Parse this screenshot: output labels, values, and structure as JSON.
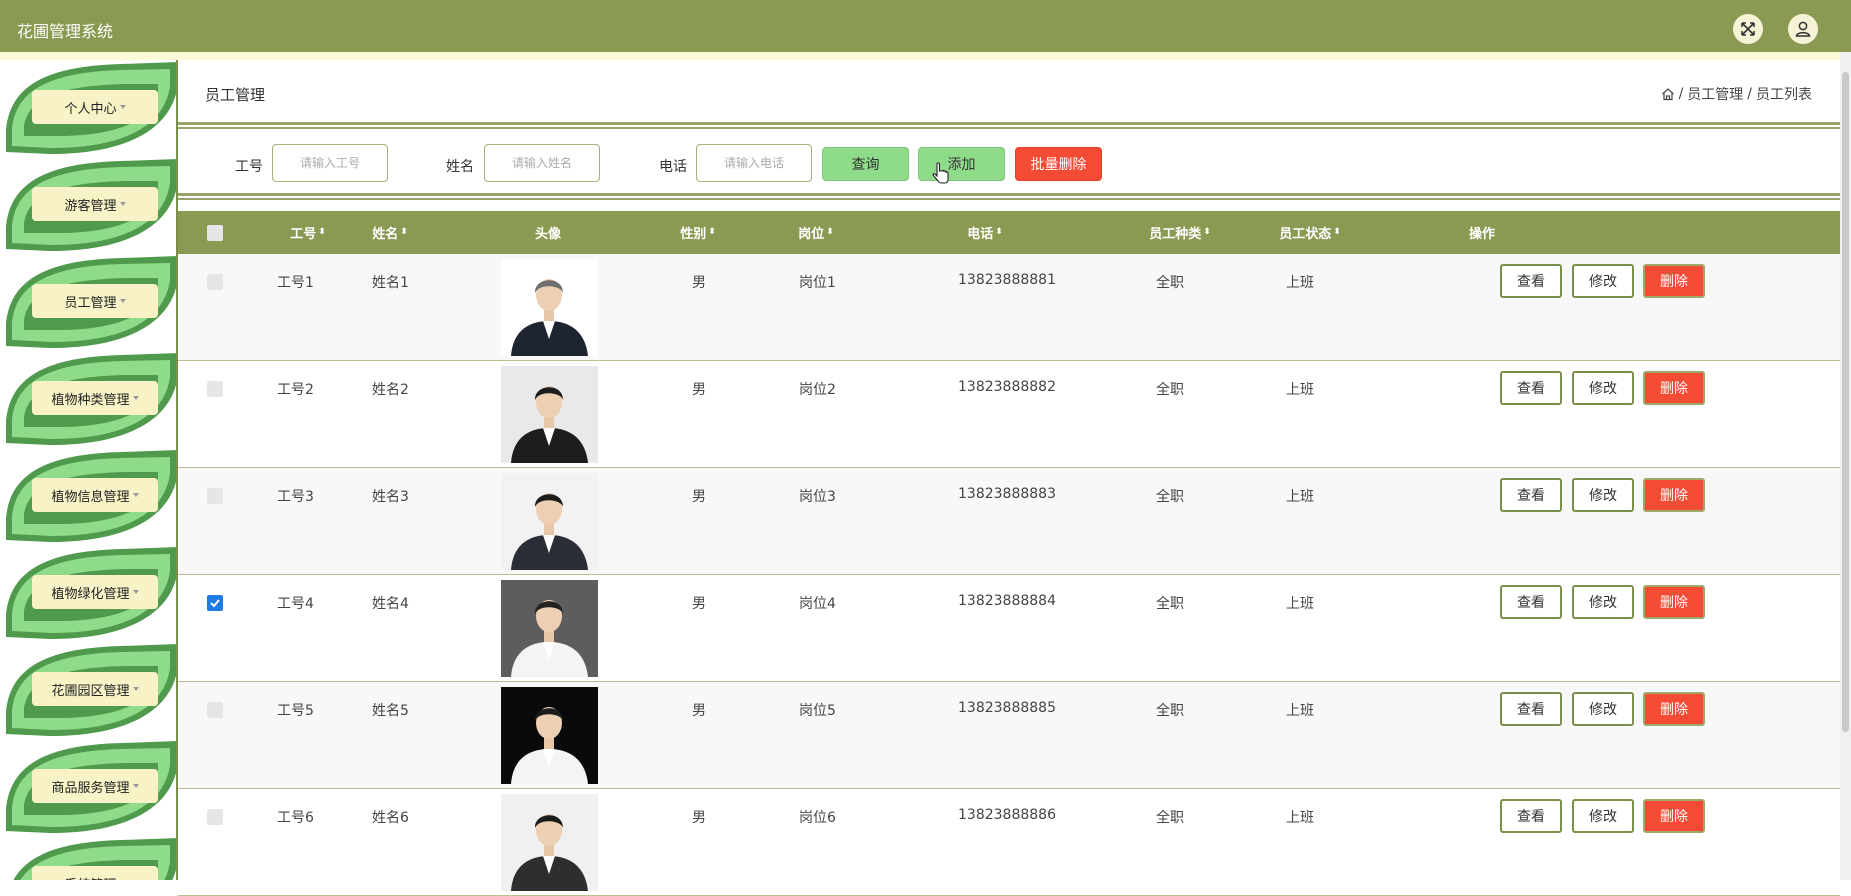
{
  "app": {
    "title": "花圃管理系统"
  },
  "header": {
    "fullscreen_icon": "fullscreen-icon",
    "user_icon": "user-icon"
  },
  "sidebar": {
    "items": [
      {
        "label": "个人中心"
      },
      {
        "label": "游客管理"
      },
      {
        "label": "员工管理"
      },
      {
        "label": "植物种类管理"
      },
      {
        "label": "植物信息管理"
      },
      {
        "label": "植物绿化管理"
      },
      {
        "label": "花圃园区管理"
      },
      {
        "label": "商品服务管理"
      },
      {
        "label": "系统管理"
      }
    ]
  },
  "page": {
    "title": "员工管理",
    "breadcrumb": {
      "sep": "/",
      "level1": "员工管理",
      "level2": "员工列表"
    }
  },
  "search": {
    "gonghao_label": "工号",
    "gonghao_placeholder": "请输入工号",
    "name_label": "姓名",
    "name_placeholder": "请输入姓名",
    "phone_label": "电话",
    "phone_placeholder": "请输入电话",
    "query_btn": "查询",
    "add_btn": "添加",
    "batch_delete_btn": "批量删除"
  },
  "table": {
    "headers": {
      "gonghao": "工号",
      "name": "姓名",
      "avatar": "头像",
      "gender": "性别",
      "post": "岗位",
      "phone": "电话",
      "type": "员工种类",
      "status": "员工状态",
      "actions": "操作"
    },
    "action_labels": {
      "view": "查看",
      "edit": "修改",
      "delete": "删除"
    },
    "rows": [
      {
        "gonghao": "工号1",
        "name": "姓名1",
        "gender": "男",
        "post": "岗位1",
        "phone": "13823888881",
        "type": "全职",
        "status": "上班",
        "checked": false
      },
      {
        "gonghao": "工号2",
        "name": "姓名2",
        "gender": "男",
        "post": "岗位2",
        "phone": "13823888882",
        "type": "全职",
        "status": "上班",
        "checked": false
      },
      {
        "gonghao": "工号3",
        "name": "姓名3",
        "gender": "男",
        "post": "岗位3",
        "phone": "13823888883",
        "type": "全职",
        "status": "上班",
        "checked": false
      },
      {
        "gonghao": "工号4",
        "name": "姓名4",
        "gender": "男",
        "post": "岗位4",
        "phone": "13823888884",
        "type": "全职",
        "status": "上班",
        "checked": true
      },
      {
        "gonghao": "工号5",
        "name": "姓名5",
        "gender": "男",
        "post": "岗位5",
        "phone": "13823888885",
        "type": "全职",
        "status": "上班",
        "checked": false
      },
      {
        "gonghao": "工号6",
        "name": "姓名6",
        "gender": "男",
        "post": "岗位6",
        "phone": "13823888886",
        "type": "全职",
        "status": "上班",
        "checked": false
      }
    ]
  },
  "colors": {
    "header_bg": "#8b9a52",
    "leaf_green": "#8edb8a",
    "leaf_dark": "#4f9a4c",
    "pill_yellow": "#f7f3c7",
    "delete_red": "#f44b35",
    "checkbox_blue": "#1e7ce3"
  }
}
